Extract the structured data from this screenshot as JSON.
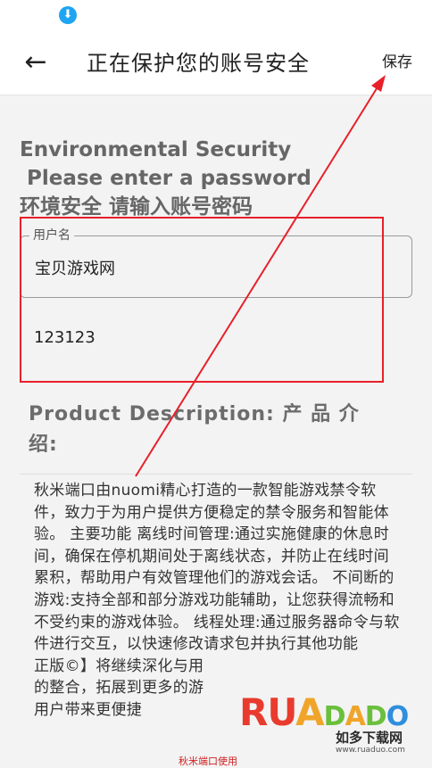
{
  "status_bar": {
    "download_icon": "download-icon"
  },
  "app_bar": {
    "back_icon": "arrow-left-icon",
    "title": "正在保护您的账号安全",
    "save_label": "保存"
  },
  "heading": {
    "line1": "Environmental Security",
    "line2": " Please enter a password",
    "line3": "环境安全 请输入账号密码"
  },
  "username_field": {
    "label": "用户名",
    "value": "宝贝游戏网"
  },
  "password_field": {
    "value": "123123"
  },
  "product": {
    "title": "Product Description: 产 品 介 绍:",
    "description": "秋米端口由nuomi精心打造的一款智能游戏禁令软件，致力于为用户提供方便稳定的禁令服务和智能体验。 主要功能 离线时间管理:通过实施健康的休息时间，确保在停机期间处于离线状态，并防止在线时间累积，帮助用户有效管理他们的游戏会话。 不间断的游戏:支持全部和部分游戏功能辅助，让您获得流畅和不受约束的游戏体验。 线程处理:通过服务器命令与软件进行交互，以快速修改请求包并执行其他功能\n正版©】将继续深化与用\n的整合，拓展到更多的游\n用户带来更便捷"
  },
  "watermark": {
    "letters": [
      "R",
      "U",
      "A",
      "D",
      "A",
      "D",
      "O"
    ],
    "subtitle": "如多下载网",
    "url": "www.ruaduo.com",
    "small": "秋米端口使用"
  },
  "colors": {
    "annotation_red": "#e8202a",
    "download_blue": "#1ea5f2"
  }
}
